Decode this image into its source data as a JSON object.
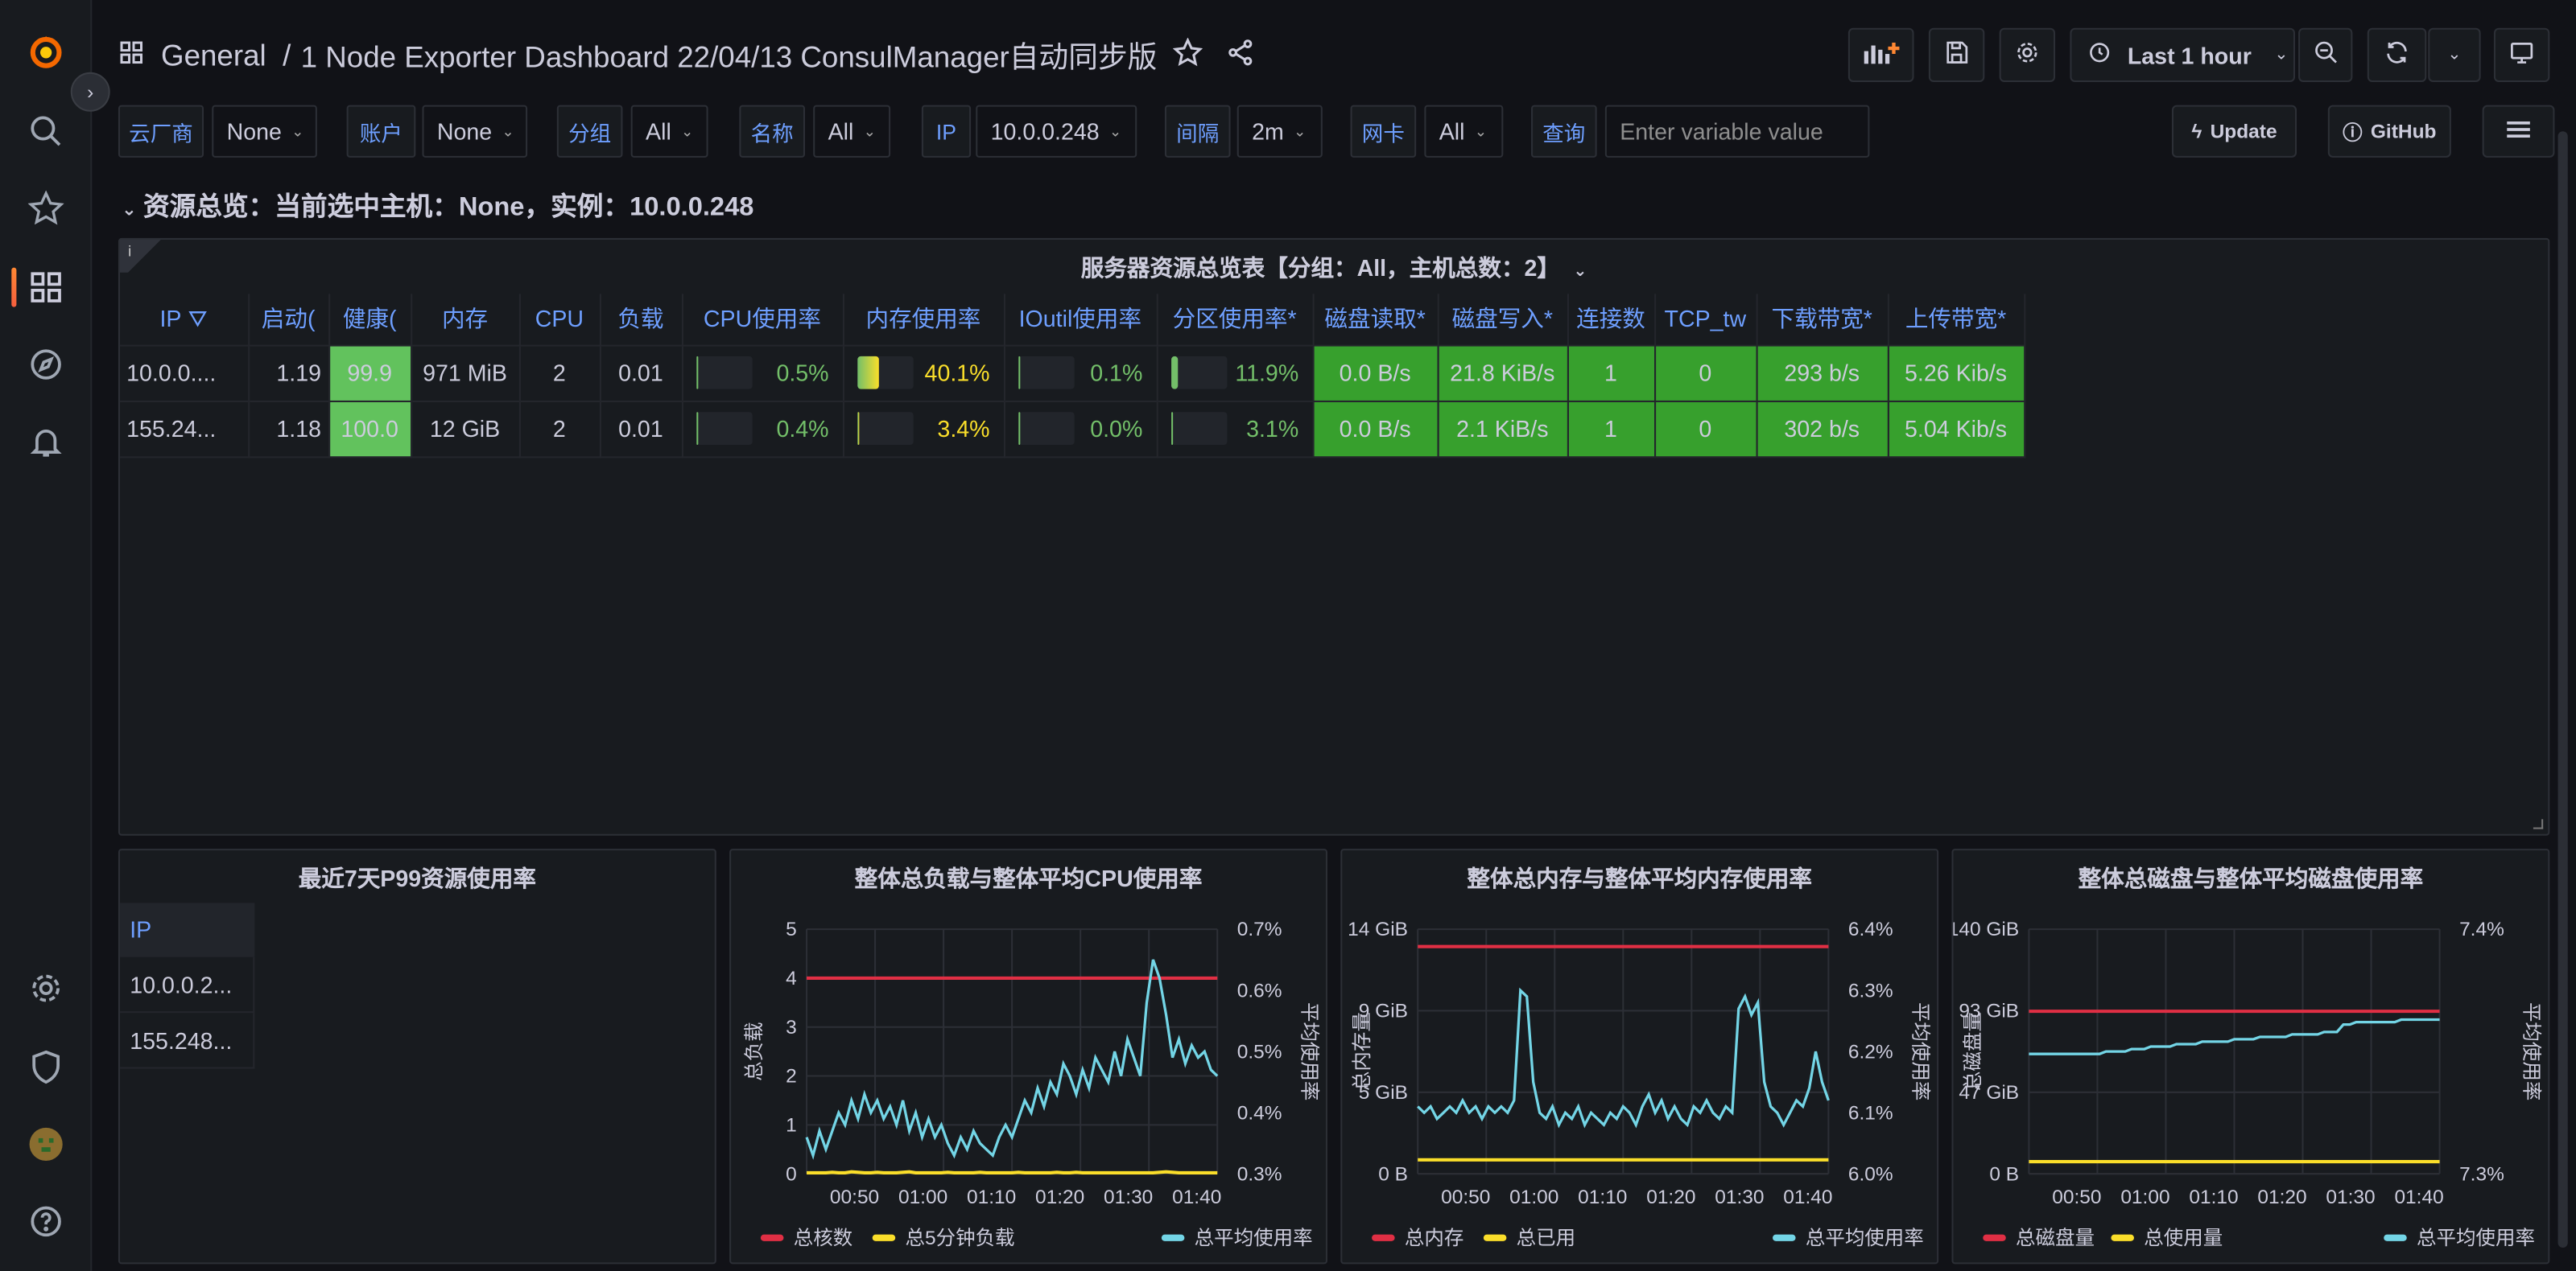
{
  "breadcrumb": {
    "folder": "General",
    "sep": "/",
    "title": "1 Node Exporter Dashboard 22/04/13 ConsulManager自动同步版"
  },
  "toolbar": {
    "time_range": "Last 1 hour"
  },
  "variables": [
    {
      "label": "云厂商",
      "value": "None"
    },
    {
      "label": "账户",
      "value": "None"
    },
    {
      "label": "分组",
      "value": "All"
    },
    {
      "label": "名称",
      "value": "All"
    },
    {
      "label": "IP",
      "value": "10.0.0.248"
    },
    {
      "label": "间隔",
      "value": "2m"
    },
    {
      "label": "网卡",
      "value": "All"
    },
    {
      "label": "查询",
      "placeholder": "Enter variable value"
    }
  ],
  "links": {
    "update": "Update",
    "github": "GitHub"
  },
  "row_title": "资源总览：当前选中主机：None，实例：10.0.0.248",
  "overview": {
    "title": "服务器资源总览表【分组：All，主机总数：2】",
    "columns": [
      "IP",
      "启动(",
      "健康(",
      "内存",
      "CPU",
      "负载",
      "CPU使用率",
      "内存使用率",
      "IOutil使用率",
      "分区使用率*",
      "磁盘读取*",
      "磁盘写入*",
      "连接数",
      "TCP_tw",
      "下载带宽*",
      "上传带宽*"
    ],
    "rows": [
      {
        "ip": "10.0.0....",
        "uptime": "1.19",
        "health": "99.9",
        "mem": "971 MiB",
        "cpu": "2",
        "load": "0.01",
        "cpu_pct": "0.5%",
        "cpu_frac": 0.005,
        "mem_pct": "40.1%",
        "mem_frac": 0.401,
        "io_pct": "0.1%",
        "io_frac": 0.001,
        "part_pct": "11.9%",
        "part_frac": 0.119,
        "disk_r": "0.0 B/s",
        "disk_w": "21.8 KiB/s",
        "conn": "1",
        "tcp_tw": "0",
        "down": "293 b/s",
        "up": "5.26 Kib/s"
      },
      {
        "ip": "155.24...",
        "uptime": "1.18",
        "health": "100.0",
        "mem": "12 GiB",
        "cpu": "2",
        "load": "0.01",
        "cpu_pct": "0.4%",
        "cpu_frac": 0.004,
        "mem_pct": "3.4%",
        "mem_frac": 0.034,
        "io_pct": "0.0%",
        "io_frac": 0.0,
        "part_pct": "3.1%",
        "part_frac": 0.031,
        "disk_r": "0.0 B/s",
        "disk_w": "2.1 KiB/s",
        "conn": "1",
        "tcp_tw": "0",
        "down": "302 b/s",
        "up": "5.04 Kib/s"
      }
    ]
  },
  "p99": {
    "title": "最近7天P99资源使用率",
    "header": "IP",
    "rows": [
      "10.0.0.2...",
      "155.248..."
    ]
  },
  "colors": {
    "red": "#e02f44",
    "yellow": "#fade2a",
    "cyan": "#73d5e6",
    "green": "#37a02d",
    "lightgreen": "#62c25d"
  },
  "chart_data": [
    {
      "type": "line",
      "title": "整体总负载与整体平均CPU使用率",
      "ylabel": "总负载",
      "y2label": "平均使用率",
      "x": [
        "00:50",
        "01:00",
        "01:10",
        "01:20",
        "01:30",
        "01:40"
      ],
      "y_ticks": [
        "0",
        "1",
        "2",
        "3",
        "4",
        "5"
      ],
      "y2_ticks": [
        "0.3%",
        "0.4%",
        "0.5%",
        "0.6%",
        "0.7%"
      ],
      "ylim": [
        0,
        5
      ],
      "y2lim": [
        0.3,
        0.7
      ],
      "series": [
        {
          "name": "总核数",
          "color": "#e02f44",
          "axis": "left",
          "values": [
            4,
            4,
            4,
            4,
            4,
            4,
            4,
            4,
            4,
            4,
            4,
            4,
            4,
            4,
            4,
            4,
            4,
            4,
            4,
            4,
            4,
            4,
            4,
            4,
            4,
            4,
            4,
            4,
            4,
            4,
            4,
            4,
            4,
            4,
            4,
            4,
            4,
            4,
            4,
            4,
            4,
            4,
            4,
            4,
            4,
            4,
            4,
            4,
            4,
            4,
            4,
            4,
            4,
            4,
            4,
            4,
            4,
            4,
            4,
            4,
            4,
            4,
            4,
            4,
            4
          ]
        },
        {
          "name": "总5分钟负载",
          "color": "#fade2a",
          "axis": "left",
          "values": [
            0.02,
            0.02,
            0.02,
            0.02,
            0.03,
            0.02,
            0.02,
            0.04,
            0.03,
            0.02,
            0.02,
            0.03,
            0.02,
            0.02,
            0.02,
            0.03,
            0.04,
            0.02,
            0.02,
            0.02,
            0.02,
            0.02,
            0.03,
            0.02,
            0.02,
            0.02,
            0.02,
            0.03,
            0.02,
            0.02,
            0.02,
            0.02,
            0.02,
            0.03,
            0.02,
            0.02,
            0.02,
            0.02,
            0.02,
            0.03,
            0.02,
            0.02,
            0.03,
            0.02,
            0.02,
            0.02,
            0.02,
            0.02,
            0.02,
            0.02,
            0.02,
            0.02,
            0.02,
            0.02,
            0.02,
            0.03,
            0.04,
            0.03,
            0.02,
            0.02,
            0.02,
            0.02,
            0.02,
            0.02,
            0.02
          ]
        },
        {
          "name": "总平均使用率",
          "color": "#73d5e6",
          "axis": "right",
          "values": [
            0.36,
            0.33,
            0.37,
            0.34,
            0.37,
            0.4,
            0.38,
            0.42,
            0.39,
            0.43,
            0.4,
            0.42,
            0.39,
            0.41,
            0.38,
            0.42,
            0.37,
            0.4,
            0.36,
            0.39,
            0.36,
            0.38,
            0.35,
            0.33,
            0.36,
            0.34,
            0.37,
            0.35,
            0.34,
            0.33,
            0.36,
            0.38,
            0.36,
            0.39,
            0.42,
            0.4,
            0.44,
            0.41,
            0.45,
            0.43,
            0.48,
            0.46,
            0.43,
            0.47,
            0.44,
            0.49,
            0.47,
            0.45,
            0.5,
            0.46,
            0.52,
            0.49,
            0.46,
            0.58,
            0.65,
            0.62,
            0.56,
            0.49,
            0.52,
            0.48,
            0.51,
            0.49,
            0.5,
            0.47,
            0.46
          ]
        }
      ]
    },
    {
      "type": "line",
      "title": "整体总内存与整体平均内存使用率",
      "ylabel": "总内存量",
      "y2label": "平均使用率",
      "x": [
        "00:50",
        "01:00",
        "01:10",
        "01:20",
        "01:30",
        "01:40"
      ],
      "y_ticks": [
        "0 B",
        "5 GiB",
        "9 GiB",
        "14 GiB"
      ],
      "y2_ticks": [
        "6.0%",
        "6.1%",
        "6.2%",
        "6.3%",
        "6.4%"
      ],
      "ylim": [
        0,
        14
      ],
      "y2lim": [
        6.0,
        6.4
      ],
      "series": [
        {
          "name": "总内存",
          "color": "#e02f44",
          "axis": "left",
          "values": [
            13,
            13,
            13,
            13,
            13,
            13,
            13,
            13,
            13,
            13,
            13,
            13,
            13,
            13,
            13,
            13,
            13,
            13,
            13,
            13,
            13,
            13,
            13,
            13,
            13,
            13,
            13,
            13,
            13,
            13,
            13,
            13,
            13,
            13,
            13,
            13,
            13,
            13,
            13,
            13,
            13,
            13,
            13,
            13,
            13,
            13,
            13,
            13,
            13,
            13,
            13,
            13,
            13,
            13,
            13,
            13,
            13,
            13,
            13,
            13,
            13,
            13,
            13,
            13,
            13
          ]
        },
        {
          "name": "总已用",
          "color": "#fade2a",
          "axis": "left",
          "values": [
            0.8,
            0.8,
            0.8,
            0.8,
            0.8,
            0.8,
            0.8,
            0.8,
            0.8,
            0.8,
            0.8,
            0.8,
            0.8,
            0.8,
            0.8,
            0.8,
            0.8,
            0.8,
            0.8,
            0.8,
            0.8,
            0.8,
            0.8,
            0.8,
            0.8,
            0.8,
            0.8,
            0.8,
            0.8,
            0.8,
            0.8,
            0.8,
            0.8,
            0.8,
            0.8,
            0.8,
            0.8,
            0.8,
            0.8,
            0.8,
            0.8,
            0.8,
            0.8,
            0.8,
            0.8,
            0.8,
            0.8,
            0.8,
            0.8,
            0.8,
            0.8,
            0.8,
            0.8,
            0.8,
            0.8,
            0.8,
            0.8,
            0.8,
            0.8,
            0.8,
            0.8,
            0.8,
            0.8,
            0.8,
            0.8
          ]
        },
        {
          "name": "总平均使用率",
          "color": "#73d5e6",
          "axis": "right",
          "values": [
            6.11,
            6.1,
            6.11,
            6.09,
            6.1,
            6.11,
            6.1,
            6.12,
            6.1,
            6.11,
            6.09,
            6.11,
            6.1,
            6.11,
            6.1,
            6.12,
            6.3,
            6.29,
            6.15,
            6.1,
            6.09,
            6.11,
            6.08,
            6.1,
            6.09,
            6.11,
            6.08,
            6.1,
            6.09,
            6.08,
            6.1,
            6.09,
            6.11,
            6.1,
            6.08,
            6.11,
            6.13,
            6.1,
            6.12,
            6.09,
            6.11,
            6.09,
            6.08,
            6.11,
            6.1,
            6.12,
            6.1,
            6.09,
            6.11,
            6.1,
            6.27,
            6.29,
            6.26,
            6.28,
            6.15,
            6.11,
            6.1,
            6.08,
            6.1,
            6.12,
            6.11,
            6.14,
            6.2,
            6.15,
            6.12
          ]
        }
      ]
    },
    {
      "type": "line",
      "title": "整体总磁盘与整体平均磁盘使用率",
      "ylabel": "总磁盘量",
      "y2label": "平均使用率",
      "x": [
        "00:50",
        "01:00",
        "01:10",
        "01:20",
        "01:30",
        "01:40"
      ],
      "y_ticks": [
        "0 B",
        "47 GiB",
        "93 GiB",
        "140 GiB"
      ],
      "y2_ticks": [
        "7.3%",
        "7.4%"
      ],
      "ylim": [
        0,
        140
      ],
      "y2lim": [
        7.3,
        7.4
      ],
      "series": [
        {
          "name": "总磁盘量",
          "color": "#e02f44",
          "axis": "left",
          "values": [
            93,
            93,
            93,
            93,
            93,
            93,
            93,
            93,
            93,
            93,
            93,
            93,
            93,
            93,
            93,
            93,
            93,
            93,
            93,
            93,
            93,
            93,
            93,
            93,
            93,
            93,
            93,
            93,
            93,
            93,
            93,
            93,
            93,
            93,
            93,
            93,
            93,
            93,
            93,
            93,
            93,
            93,
            93,
            93,
            93,
            93,
            93,
            93,
            93,
            93,
            93,
            93,
            93,
            93,
            93,
            93,
            93,
            93,
            93,
            93,
            93,
            93,
            93,
            93,
            93
          ]
        },
        {
          "name": "总使用量",
          "color": "#fade2a",
          "axis": "left",
          "values": [
            7,
            7,
            7,
            7,
            7,
            7,
            7,
            7,
            7,
            7,
            7,
            7,
            7,
            7,
            7,
            7,
            7,
            7,
            7,
            7,
            7,
            7,
            7,
            7,
            7,
            7,
            7,
            7,
            7,
            7,
            7,
            7,
            7,
            7,
            7,
            7,
            7,
            7,
            7,
            7,
            7,
            7,
            7,
            7,
            7,
            7,
            7,
            7,
            7,
            7,
            7,
            7,
            7,
            7,
            7,
            7,
            7,
            7,
            7,
            7,
            7,
            7,
            7,
            7,
            7
          ]
        },
        {
          "name": "总平均使用率",
          "color": "#73d5e6",
          "axis": "right",
          "values": [
            7.349,
            7.349,
            7.349,
            7.349,
            7.349,
            7.349,
            7.349,
            7.349,
            7.349,
            7.349,
            7.349,
            7.349,
            7.35,
            7.35,
            7.35,
            7.35,
            7.351,
            7.351,
            7.351,
            7.352,
            7.352,
            7.352,
            7.352,
            7.353,
            7.353,
            7.353,
            7.353,
            7.354,
            7.354,
            7.354,
            7.354,
            7.354,
            7.355,
            7.355,
            7.355,
            7.355,
            7.356,
            7.356,
            7.356,
            7.356,
            7.356,
            7.357,
            7.357,
            7.357,
            7.357,
            7.357,
            7.358,
            7.358,
            7.358,
            7.361,
            7.361,
            7.362,
            7.362,
            7.362,
            7.362,
            7.362,
            7.362,
            7.362,
            7.363,
            7.363,
            7.363,
            7.363,
            7.363,
            7.363,
            7.363
          ]
        }
      ]
    }
  ]
}
